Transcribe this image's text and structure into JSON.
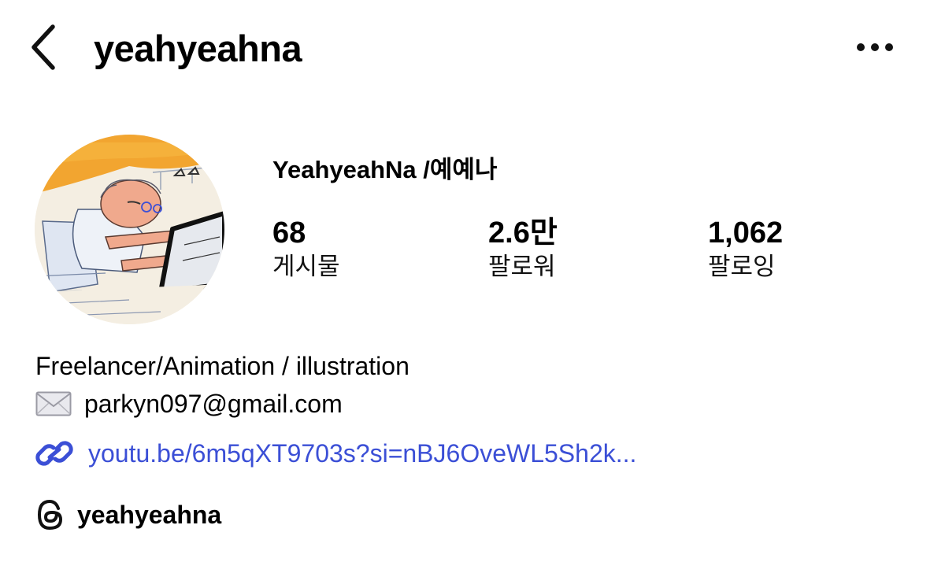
{
  "header": {
    "username": "yeahyeahna",
    "back_icon": "chevron-left-icon",
    "more_icon": "more-horizontal-icon"
  },
  "profile": {
    "display_name": "YeahyeahNa /예예나",
    "stats": [
      {
        "value": "68",
        "label": "게시물"
      },
      {
        "value": "2.6만",
        "label": "팔로워"
      },
      {
        "value": "1,062",
        "label": "팔로잉"
      }
    ]
  },
  "bio": {
    "line1": "Freelancer/Animation / illustration",
    "email": "parkyn097@gmail.com",
    "email_icon": "envelope-icon",
    "link": "youtu.be/6m5qXT9703s?si=nBJ6OveWL5Sh2k...",
    "link_icon": "link-icon",
    "link_color": "#3b4fd6"
  },
  "threads": {
    "handle": "yeahyeahna",
    "icon": "threads-icon"
  }
}
